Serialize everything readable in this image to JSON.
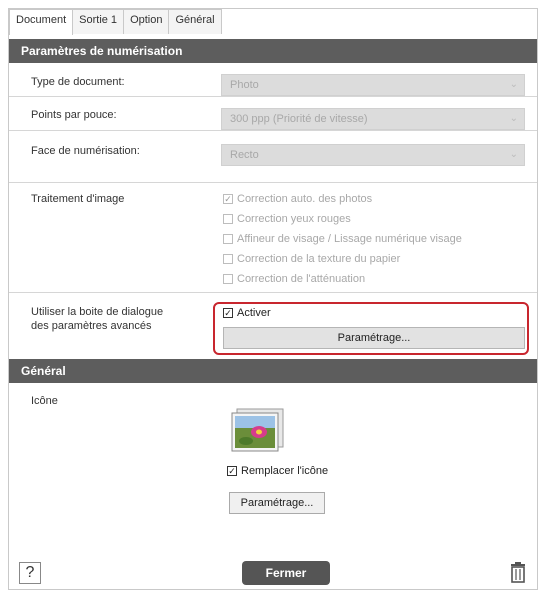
{
  "tabs": [
    "Document",
    "Sortie 1",
    "Option",
    "Général"
  ],
  "scan_section": {
    "title": "Paramètres de numérisation",
    "doc_type": {
      "label": "Type de document:",
      "value": "Photo"
    },
    "dpi": {
      "label": "Points par pouce:",
      "value": "300 ppp (Priorité de vitesse)"
    },
    "scan_face": {
      "label": "Face de numérisation:",
      "value": "Recto"
    },
    "image_processing": {
      "label": "Traitement d'image",
      "options": [
        {
          "label": "Correction auto. des photos",
          "checked": true
        },
        {
          "label": "Correction yeux rouges",
          "checked": false
        },
        {
          "label": "Affineur de visage / Lissage numérique visage",
          "checked": false
        },
        {
          "label": "Correction de la texture du papier",
          "checked": false
        },
        {
          "label": "Correction de l'atténuation",
          "checked": false
        }
      ]
    },
    "advanced": {
      "label_line1": "Utiliser la boite de dialogue",
      "label_line2": "des paramètres avancés",
      "enable_label": "Activer",
      "enable_checked": true,
      "settings_button": "Paramétrage..."
    }
  },
  "general_section": {
    "title": "Général",
    "icon_label": "Icône",
    "replace_icon_label": "Remplacer l'icône",
    "replace_icon_checked": true,
    "settings_button": "Paramétrage..."
  },
  "footer": {
    "help_label": "?",
    "close_button": "Fermer"
  },
  "colors": {
    "section_header": "#5d5d5d",
    "highlight": "#c8262e",
    "close_button": "#555555"
  }
}
